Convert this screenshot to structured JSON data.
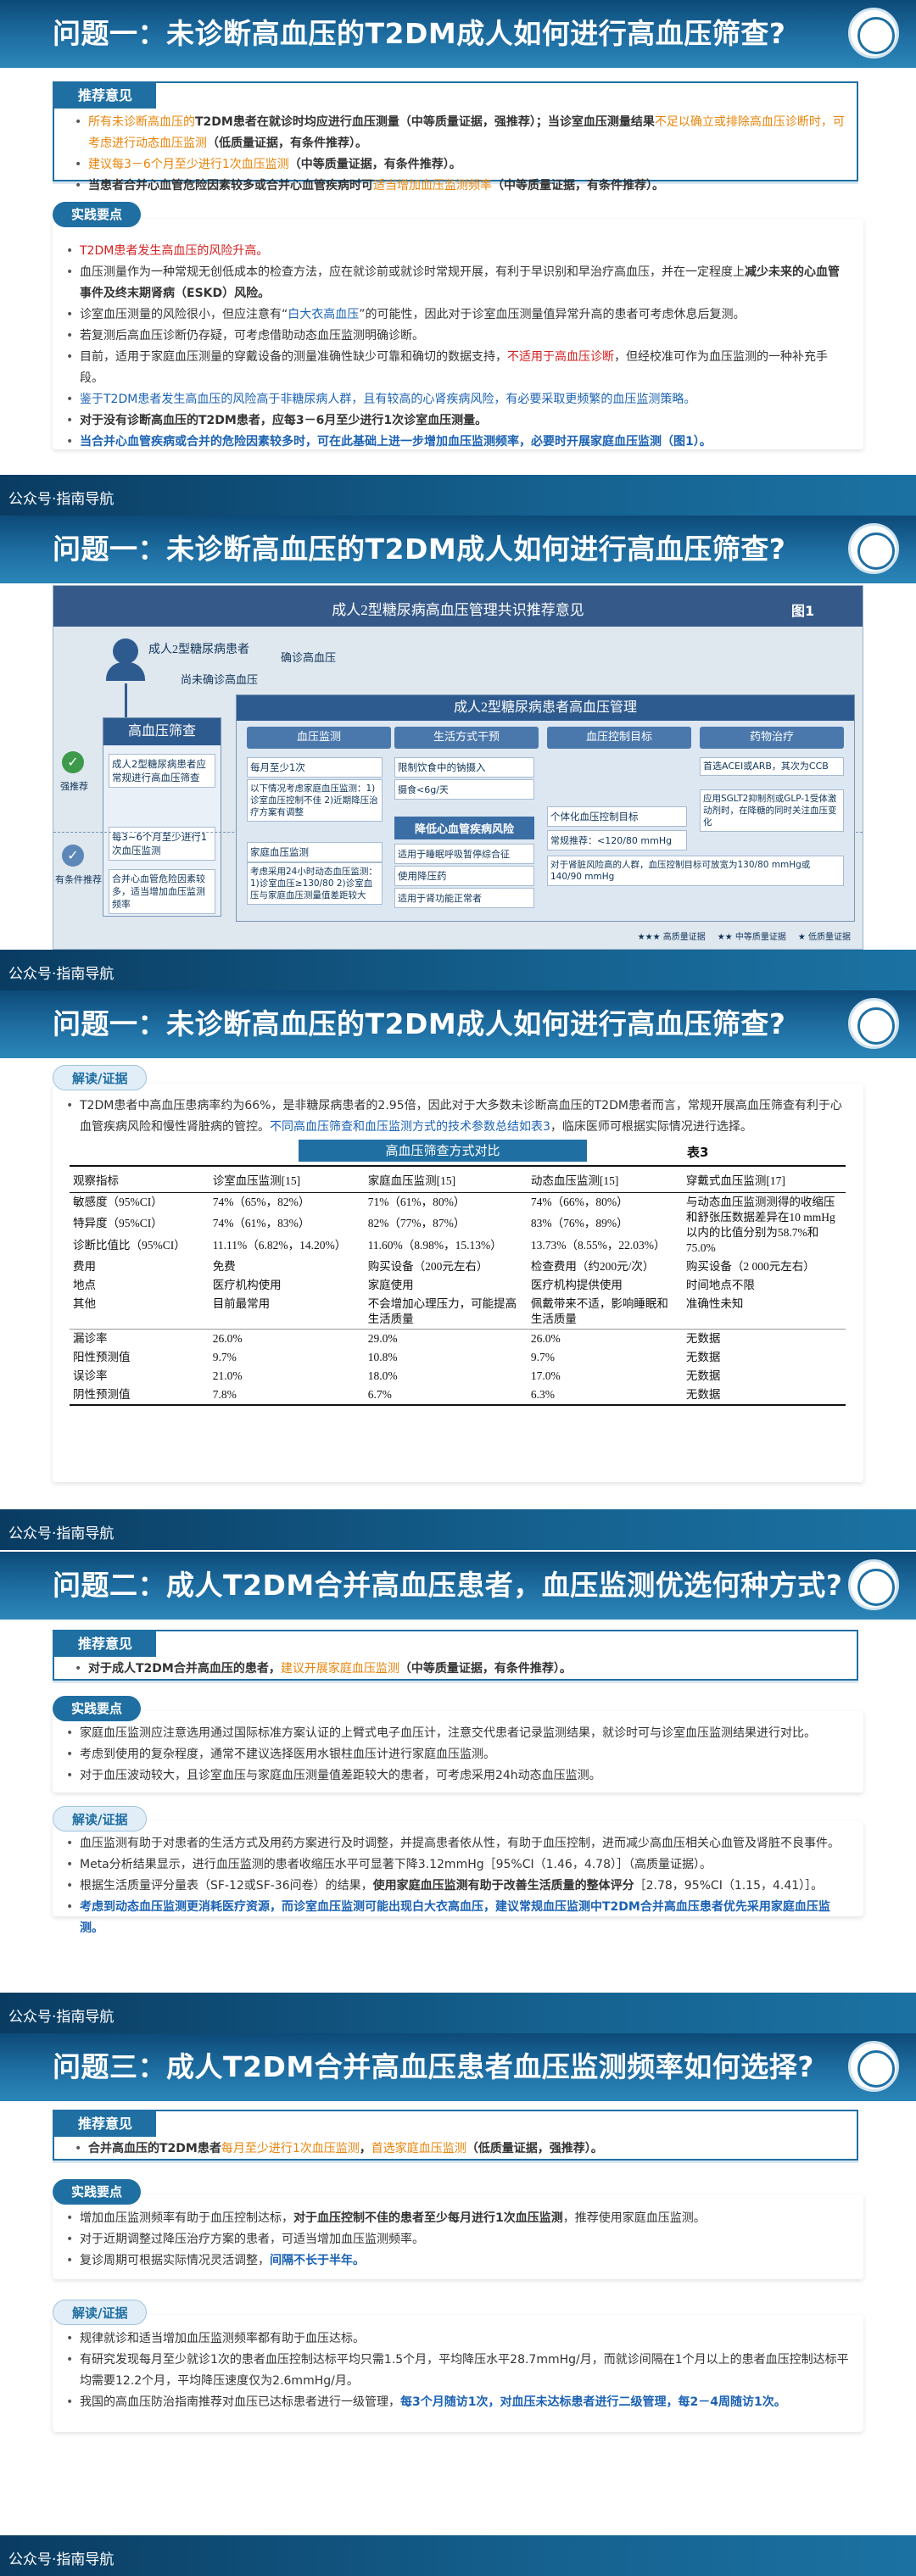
{
  "footer_text": "公众号·指南导航",
  "slides": {
    "s1": {
      "title": "问题一：未诊断高血压的T2DM成人如何进行高血压筛查?",
      "rec_label": "推荐意见",
      "rec_items": [
        [
          [
            "所有未诊断高血压的",
            "orange"
          ],
          [
            "T2DM患者在就诊时均应进行血压测量（中等质量证据，强推荐）；当诊室血压测量结果",
            "bold"
          ],
          [
            "不足以确立或排除高血压诊断时，可考虑进行动态血压监测",
            "orange"
          ],
          [
            "（低质量证据，有条件推荐）。",
            "bold"
          ]
        ],
        [
          [
            "建议每3－6个月至少进行1次血压监测",
            "orange"
          ],
          [
            "（中等质量证据，有条件推荐）。",
            "bold"
          ]
        ],
        [
          [
            "当患者合并心血管危险因素较多或合并心血管疾病时可",
            "bold"
          ],
          [
            "适当增加血压监测频率",
            "orange"
          ],
          [
            "（中等质量证据，有条件推荐）。",
            "bold"
          ]
        ]
      ],
      "key_label": "实践要点",
      "key_items": [
        [
          [
            "T2DM患者发生高血压的风险升高。",
            "red"
          ]
        ],
        [
          [
            "血压测量作为一种常规无创低成本的检查方法，应在就诊前或就诊时常规开展，有利于早识别和早治疗高血压，并在一定程度上",
            ""
          ],
          [
            "减少未来的心血管事件及终末期肾病（ESKD）风险。",
            "bold"
          ]
        ],
        [
          [
            "诊室血压测量的风险很小，但应注意有“",
            ""
          ],
          [
            "白大衣高血压",
            "blue"
          ],
          [
            "”的可能性，因此对于诊室血压测量值异常升高的患者可考虑休息后复测。",
            ""
          ]
        ],
        [
          [
            "若复测后高血压诊断仍存疑，可考虑借助动态血压监测明确诊断。",
            ""
          ]
        ],
        [
          [
            "目前，适用于家庭血压测量的穿戴设备的测量准确性缺少可靠和确切的数据支持，",
            ""
          ],
          [
            "不适用于高血压诊断",
            "red"
          ],
          [
            "，但经校准可作为血压监测的一种补充手段。",
            ""
          ]
        ],
        [
          [
            "鉴于T2DM患者发生高血压的风险高于非糖尿病人群，且有较高的心肾疾病风险，有必要采取更频繁的血压监测策略。",
            "blue"
          ]
        ],
        [
          [
            "对于没有诊断高血压的T2DM患者，应每3－6月至少进行1次诊室血压测量。",
            "bold"
          ]
        ],
        [
          [
            "当合并心血管疾病或合并的危险因素较多时，可在此基础上进一步增加血压监测频率，必要时开展家庭血压监测（图1）。",
            "blue bold"
          ]
        ]
      ]
    },
    "s2": {
      "title": "问题一：未诊断高血压的T2DM成人如何进行高血压筛查?",
      "fig_title": "成人2型糖尿病高血压管理共识推荐意见",
      "fig_label": "图1",
      "fig_patient": "成人2型糖尿病患者",
      "fig_undiag": "尚未确诊高血压",
      "fig_confirmed": "确诊高血压",
      "fig_screen": "高血压筛查",
      "fig_manage": "成人2型糖尿病患者高血压管理",
      "fig_cols": [
        "血压监测",
        "生活方式干预",
        "血压控制目标",
        "药物治疗"
      ],
      "fig_strong": "强推荐",
      "fig_cond": "有条件推荐",
      "fig_screen1": "成人2型糖尿病患者应常规进行高血压筛查",
      "fig_screen2": "每3~6个月至少进行1次血压监测",
      "fig_screen3": "合并心血管危险因素较多，适当增加血压监测频率",
      "fig_bp1": "每月至少1次",
      "fig_bp2": "以下情况考虑家庭血压监测：1)诊室血压控制不佳 2)近期降压治疗方案有调整",
      "fig_bp3": "家庭血压监测",
      "fig_bp4": "考虑采用24小时动态血压监测：1)诊室血压≥130/80 2)诊室血压与家庭血压测量值差距较大",
      "fig_life1": "限制饮食中的钠摄入",
      "fig_life2": "摄食<6g/天",
      "fig_life3": "降低心血管疾病风险",
      "fig_life4": "适用于睡眠呼吸暂停综合征",
      "fig_life5": "适用于肾功能正常者",
      "fig_life6": "使用降压药",
      "fig_target1": "个体化血压控制目标",
      "fig_target2": "常规推荐：<120/80 mmHg",
      "fig_target3": "对于肾脏风险高的人群，血压控制目标可放宽为130/80 mmHg或140/90 mmHg",
      "fig_drug1": "首选ACEI或ARB，其次为CCB",
      "fig_drug2": "应用SGLT2抑制剂或GLP-1受体激动剂时，在降糖的同时关注血压变化",
      "fig_legend": [
        "★★★ 高质量证据",
        "★★ 中等质量证据",
        "★ 低质量证据"
      ]
    },
    "s3": {
      "title": "问题一：未诊断高血压的T2DM成人如何进行高血压筛查?",
      "evid_label": "解读/证据",
      "evid_text": [
        [
          "T2DM患者中高血压患病率约为66%，是非糖尿病患者的2.95倍，因此对于大多数未诊断高血压的T2DM患者而言，常规开展高血压筛查有利于心血管疾病风险和慢性肾脏病的管控。",
          ""
        ],
        [
          "不同高血压筛查和血压监测方式的技术参数总结如表3",
          "blue"
        ],
        [
          "，临床医师可根据实际情况进行选择。",
          ""
        ]
      ],
      "table_banner": "高血压筛查方式对比",
      "table_label": "表3",
      "table_headers": [
        "观察指标",
        "诊室血压监测[15]",
        "家庭血压监测[15]",
        "动态血压监测[15]",
        "穿戴式血压监测[17]"
      ],
      "table_rows": [
        [
          "敏感度（95%CI）",
          "74%（65%，82%）",
          "71%（61%，80%）",
          "74%（66%，80%）",
          "与动态血压监测测得的收缩压和舒张压数据差异在10 mmHg以内的比值分别为58.7%和75.0%"
        ],
        [
          "特异度（95%CI）",
          "74%（61%，83%）",
          "82%（77%，87%）",
          "83%（76%，89%）",
          ""
        ],
        [
          "诊断比值比（95%CI）",
          "11.11%（6.82%，14.20%）",
          "11.60%（8.98%，15.13%）",
          "13.73%（8.55%，22.03%）",
          ""
        ],
        [
          "费用",
          "免费",
          "购买设备（200元左右）",
          "检查费用（约200元/次）",
          "购买设备（2 000元左右）"
        ],
        [
          "地点",
          "医疗机构使用",
          "家庭使用",
          "医疗机构提供使用",
          "时间地点不限"
        ],
        [
          "其他",
          "目前最常用",
          "不会增加心理压力，可能提高生活质量",
          "佩戴带来不适，影响睡眠和生活质量",
          "准确性未知"
        ],
        [
          "漏诊率",
          "26.0%",
          "29.0%",
          "26.0%",
          "无数据"
        ],
        [
          "阳性预测值",
          "9.7%",
          "10.8%",
          "9.7%",
          "无数据"
        ],
        [
          "误诊率",
          "21.0%",
          "18.0%",
          "17.0%",
          "无数据"
        ],
        [
          "阴性预测值",
          "7.8%",
          "6.7%",
          "6.3%",
          "无数据"
        ]
      ]
    },
    "s4": {
      "title": "问题二：成人T2DM合并高血压患者，血压监测优选何种方式?",
      "rec_label": "推荐意见",
      "rec_items": [
        [
          [
            "对于成人T2DM合并高血压的患者，",
            "bold"
          ],
          [
            "建议开展家庭血压监测",
            "orange"
          ],
          [
            "（中等质量证据，有条件推荐）。",
            "bold"
          ]
        ]
      ],
      "key_label": "实践要点",
      "key_items": [
        [
          [
            "家庭血压监测应注意选用通过国际标准方案认证的上臂式电子血压计，注意交代患者记录监测结果，就诊时可与诊室血压监测结果进行对比。",
            ""
          ]
        ],
        [
          [
            "考虑到使用的复杂程度，通常不建议选择医用水银柱血压计进行家庭血压监测。",
            ""
          ]
        ],
        [
          [
            "对于血压波动较大，且诊室血压与家庭血压测量值差距较大的患者，可考虑采用24h动态血压监测。",
            ""
          ]
        ]
      ],
      "evid_label": "解读/证据",
      "evid_items": [
        [
          [
            "血压监测有助于对患者的生活方式及用药方案进行及时调整，并提高患者依从性，有助于血压控制，进而减少高血压相关心血管及肾脏不良事件。",
            ""
          ]
        ],
        [
          [
            "Meta分析结果显示，进行血压监测的患者收缩压水平可显著下降3.12mmHg［95%CI（1.46，4.78）］（高质量证据）。",
            ""
          ]
        ],
        [
          [
            "根据生活质量评分量表（SF-12或SF-36问卷）的结果，",
            ""
          ],
          [
            "使用家庭血压监测有助于改善生活质量的整体评分",
            "bold"
          ],
          [
            "［2.78，95%CI（1.15，4.41）］。",
            ""
          ]
        ],
        [
          [
            "考虑到动态血压监测更消耗医疗资源，而诊室血压监测可能出现白大衣高血压，建议常规血压监测中T2DM合并高血压患者优先采用家庭血压监测。",
            "blue bold"
          ]
        ]
      ]
    },
    "s5": {
      "title": "问题三：成人T2DM合并高血压患者血压监测频率如何选择?",
      "rec_label": "推荐意见",
      "rec_items": [
        [
          [
            "合并高血压的T2DM患者",
            "bold"
          ],
          [
            "每月至少进行1次血压监测",
            "orange"
          ],
          [
            "，",
            "bold"
          ],
          [
            "首选家庭血压监测",
            "orange"
          ],
          [
            "（低质量证据，强推荐）。",
            "bold"
          ]
        ]
      ],
      "key_label": "实践要点",
      "key_items": [
        [
          [
            "增加血压监测频率有助于血压控制达标，",
            ""
          ],
          [
            "对于血压控制不佳的患者至少每月进行1次血压监测",
            "bold"
          ],
          [
            "，推荐使用家庭血压监测。",
            ""
          ]
        ],
        [
          [
            "对于近期调整过降压治疗方案的患者，可适当增加血压监测频率。",
            ""
          ]
        ],
        [
          [
            "复诊周期可根据实际情况灵活调整，",
            ""
          ],
          [
            "间隔不长于半年。",
            "blue bold"
          ]
        ]
      ],
      "evid_label": "解读/证据",
      "evid_items": [
        [
          [
            "规律就诊和适当增加血压监测频率都有助于血压达标。",
            ""
          ]
        ],
        [
          [
            "有研究发现每月至少就诊1次的患者血压控制达标平均只需1.5个月，平均降压水平28.7mmHg/月，而就诊间隔在1个月以上的患者血压控制达标平均需要12.2个月，平均降压速度仅为2.6mmHg/月。",
            ""
          ]
        ],
        [
          [
            "我国的高血压防治指南推荐对血压已达标患者进行一级管理，",
            ""
          ],
          [
            "每3个月随访1次，对血压未达标患者进行二级管理，每2－4周随访1次。",
            "blue bold"
          ]
        ]
      ]
    }
  }
}
